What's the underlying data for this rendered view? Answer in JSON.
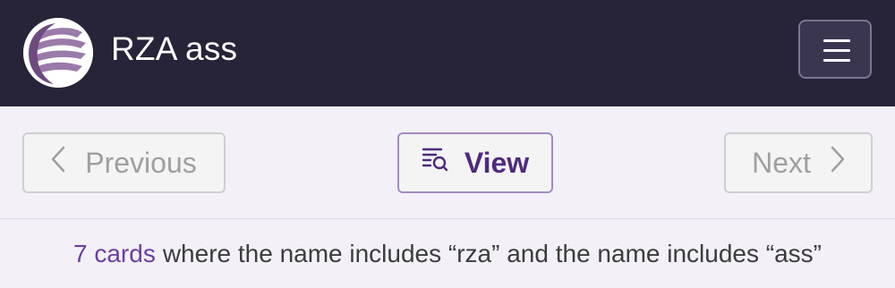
{
  "header": {
    "site_title": "RZA ass",
    "logo_icon": "scryfall-logo-icon",
    "menu_icon": "hamburger-menu-icon"
  },
  "nav": {
    "previous_label": "Previous",
    "view_label": "View",
    "next_label": "Next",
    "previous_icon": "chevron-left-icon",
    "next_icon": "chevron-right-icon",
    "view_icon": "list-search-icon"
  },
  "summary": {
    "count_text": "7 cards",
    "description": "where the name includes “rza” and the name includes “ass”"
  },
  "colors": {
    "header_bg": "#272339",
    "page_bg": "#f3f0f8",
    "accent": "#6b3fa0",
    "view_text": "#4f2a7e"
  }
}
